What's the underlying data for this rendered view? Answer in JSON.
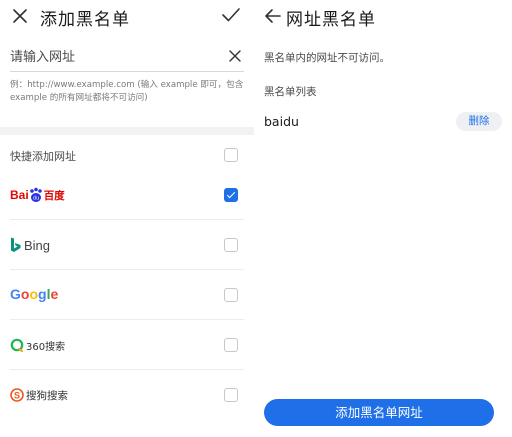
{
  "left": {
    "title": "添加黑名单",
    "url_input": {
      "placeholder": "请输入网址",
      "value": ""
    },
    "hint": "例：http://www.example.com (输入 example 即可，包含 example 的所有网址都将不可访问)",
    "quick_add_label": "快捷添加网址",
    "quick_add_checked": false,
    "engines": [
      {
        "name": "Baidu",
        "label": "百度",
        "checked": true
      },
      {
        "name": "Bing",
        "label": "Bing",
        "checked": false
      },
      {
        "name": "Google",
        "label": "Google",
        "checked": false
      },
      {
        "name": "360",
        "label": "360搜索",
        "checked": false
      },
      {
        "name": "Sogou",
        "label": "搜狗搜索",
        "checked": false
      }
    ]
  },
  "right": {
    "title": "网址黑名单",
    "description": "黑名单内的网址不可访问。",
    "list_header": "黑名单列表",
    "items": [
      {
        "name": "baidu",
        "delete_label": "删除"
      }
    ],
    "add_button_label": "添加黑名单网址"
  },
  "colors": {
    "accent": "#1f6fe8"
  }
}
